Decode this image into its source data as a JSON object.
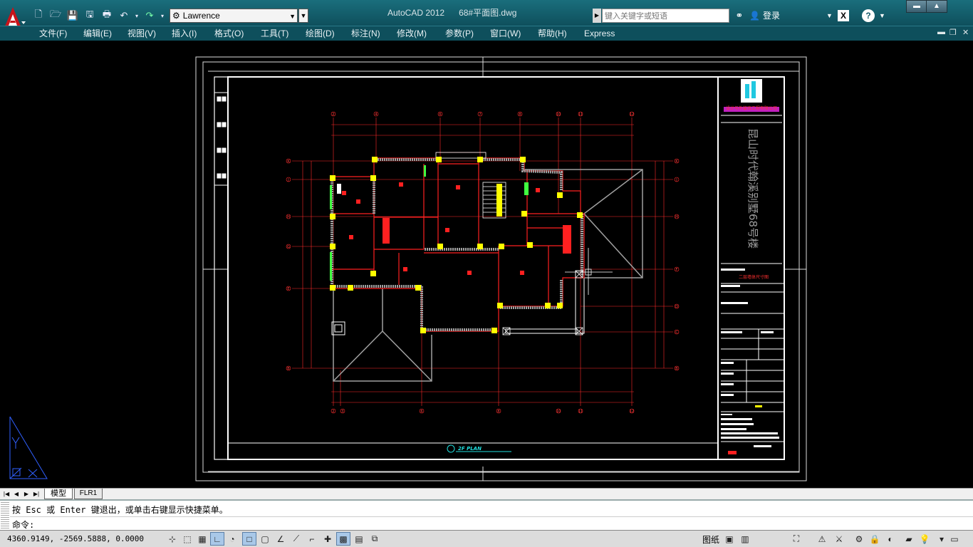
{
  "app": {
    "window_title": "AutoCAD 2012",
    "document": "68#平面图.dwg",
    "workspace": "Lawrence",
    "search_placeholder": "键入关键字或短语",
    "login": "登录",
    "help": "?",
    "x_icon_label": "X"
  },
  "menu": [
    "文件(F)",
    "编辑(E)",
    "视图(V)",
    "插入(I)",
    "格式(O)",
    "工具(T)",
    "绘图(D)",
    "标注(N)",
    "修改(M)",
    "参数(P)",
    "窗口(W)",
    "帮助(H)",
    "Express"
  ],
  "drawing": {
    "vertical_title": "昆山时代翰溪别墅68号楼",
    "company_label": "设计与外装饰工程有限公司",
    "plan_label": "2F PLAN",
    "sheet_subtitle": "二层墙体尺寸图",
    "axes_top": [
      "2",
      "4",
      "6",
      "7",
      "8",
      "10",
      "11",
      "12"
    ],
    "axes_bottom": [
      "2",
      "3",
      "6",
      "8",
      "10",
      "11",
      "12"
    ],
    "axes_right": [
      "K",
      "J",
      "H",
      "G",
      "F",
      "D",
      "C",
      "B"
    ],
    "axes_left": [
      "K",
      "J",
      "H",
      "G",
      "E",
      "B"
    ],
    "colors": {
      "wall": "#ff2020",
      "column": "#ffff00",
      "dimension": "#ff2a2a",
      "frame": "#ffffff",
      "hatch": "#a0a0a0",
      "green": "#40ff40",
      "logo": "#20e0e0"
    }
  },
  "tabs": {
    "model": "模型",
    "layout": "FLR1"
  },
  "command": {
    "history": "按 Esc 或 Enter 键退出，或单击右键显示快捷菜单。",
    "prompt": "命令:"
  },
  "status": {
    "coordinates": "4360.9149, -2569.5888, 0.0000",
    "paper": "图纸"
  }
}
